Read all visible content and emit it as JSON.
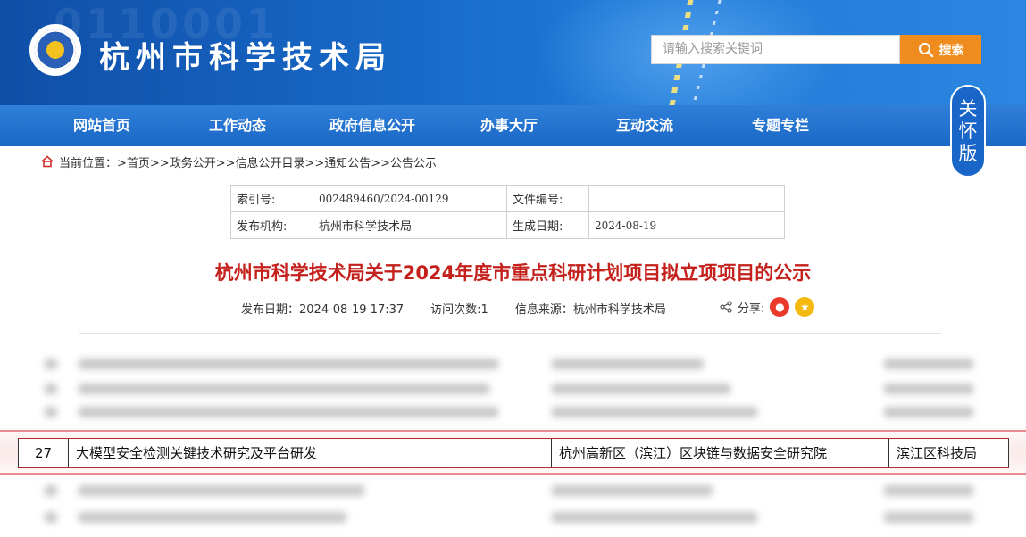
{
  "header": {
    "site_title": "杭州市科学技术局",
    "search_placeholder": "请输入搜索关键词",
    "search_button": "搜索"
  },
  "nav": {
    "items": [
      "网站首页",
      "工作动态",
      "政府信息公开",
      "办事大厅",
      "互动交流",
      "专题专栏"
    ]
  },
  "care_mode": {
    "chars": [
      "关",
      "怀",
      "版"
    ]
  },
  "breadcrumb": {
    "prefix": "当前位置：",
    "path": ">首页>>政务公开>>信息公开目录>>通知公告>>公告公示"
  },
  "meta": {
    "index_label": "索引号:",
    "index_value": "002489460/2024-00129",
    "doc_no_label": "文件编号:",
    "doc_no_value": "",
    "issuer_label": "发布机构:",
    "issuer_value": "杭州市科学技术局",
    "date_label": "生成日期:",
    "date_value": "2024-08-19"
  },
  "article": {
    "title": "杭州市科学技术局关于2024年度市重点科研计划项目拟立项项目的公示",
    "publish_date": "发布日期：2024-08-19 17:37",
    "visits": "访问次数:1",
    "source": "信息来源：杭州市科学技术局",
    "share_label": "分享:"
  },
  "highlight_row": {
    "no": "27",
    "project": "大模型安全检测关键技术研究及平台研发",
    "unit": "杭州高新区（滨江）区块链与数据安全研究院",
    "dept": "滨江区科技局"
  },
  "colors": {
    "brand_blue": "#1b68c6",
    "title_red": "#c4211d",
    "search_orange": "#f08b1d"
  }
}
